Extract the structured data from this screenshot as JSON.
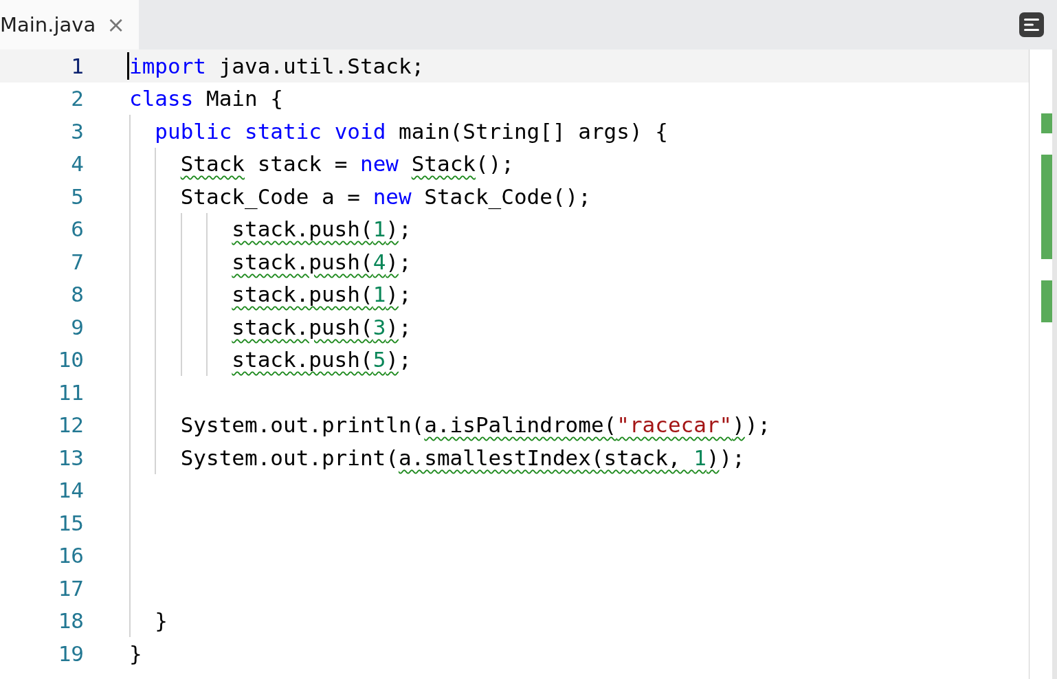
{
  "tabs": [
    {
      "label": "Main.java",
      "selected": true,
      "close": "×"
    }
  ],
  "lines": [
    {
      "number": "1",
      "current": true,
      "tokens": [
        {
          "text": "import",
          "kind": "keyword",
          "warning": false
        },
        {
          "text": " java.util.Stack;",
          "kind": "plain",
          "warning": false
        }
      ]
    },
    {
      "number": "2",
      "current": false,
      "tokens": [
        {
          "text": "class",
          "kind": "keyword",
          "warning": false
        },
        {
          "text": " Main {",
          "kind": "plain",
          "warning": false
        }
      ]
    },
    {
      "number": "3",
      "current": false,
      "tokens": [
        {
          "text": "  public",
          "kind": "keyword",
          "warning": false
        },
        {
          "text": " static",
          "kind": "keyword",
          "warning": false
        },
        {
          "text": " void",
          "kind": "keyword",
          "warning": false
        },
        {
          "text": " main(String[] args) {",
          "kind": "plain",
          "warning": false
        }
      ]
    },
    {
      "number": "4",
      "current": false,
      "tokens": [
        {
          "text": "    Stack",
          "kind": "plain",
          "warning": true
        },
        {
          "text": " stack =",
          "kind": "plain",
          "warning": false
        },
        {
          "text": " new",
          "kind": "keyword",
          "warning": false
        },
        {
          "text": " Stack",
          "kind": "plain",
          "warning": true
        },
        {
          "text": "();",
          "kind": "plain",
          "warning": false
        }
      ]
    },
    {
      "number": "5",
      "current": false,
      "tokens": [
        {
          "text": "    Stack_Code a =",
          "kind": "plain",
          "warning": false
        },
        {
          "text": " new",
          "kind": "keyword",
          "warning": false
        },
        {
          "text": " Stack_Code();",
          "kind": "plain",
          "warning": false
        }
      ]
    },
    {
      "number": "6",
      "current": false,
      "tokens": [
        {
          "text": "        stack.push(",
          "kind": "plain",
          "warning": true
        },
        {
          "text": "1",
          "kind": "number",
          "warning": true
        },
        {
          "text": ")",
          "kind": "plain",
          "warning": true
        },
        {
          "text": ";",
          "kind": "plain",
          "warning": false
        }
      ]
    },
    {
      "number": "7",
      "current": false,
      "tokens": [
        {
          "text": "        stack.push(",
          "kind": "plain",
          "warning": true
        },
        {
          "text": "4",
          "kind": "number",
          "warning": true
        },
        {
          "text": ")",
          "kind": "plain",
          "warning": true
        },
        {
          "text": ";",
          "kind": "plain",
          "warning": false
        }
      ]
    },
    {
      "number": "8",
      "current": false,
      "tokens": [
        {
          "text": "        stack.push(",
          "kind": "plain",
          "warning": true
        },
        {
          "text": "1",
          "kind": "number",
          "warning": true
        },
        {
          "text": ")",
          "kind": "plain",
          "warning": true
        },
        {
          "text": ";",
          "kind": "plain",
          "warning": false
        }
      ]
    },
    {
      "number": "9",
      "current": false,
      "tokens": [
        {
          "text": "        stack.push(",
          "kind": "plain",
          "warning": true
        },
        {
          "text": "3",
          "kind": "number",
          "warning": true
        },
        {
          "text": ")",
          "kind": "plain",
          "warning": true
        },
        {
          "text": ";",
          "kind": "plain",
          "warning": false
        }
      ]
    },
    {
      "number": "10",
      "current": false,
      "tokens": [
        {
          "text": "        stack.push(",
          "kind": "plain",
          "warning": true
        },
        {
          "text": "5",
          "kind": "number",
          "warning": true
        },
        {
          "text": ")",
          "kind": "plain",
          "warning": true
        },
        {
          "text": ";",
          "kind": "plain",
          "warning": false
        }
      ]
    },
    {
      "number": "11",
      "current": false
    },
    {
      "number": "12",
      "current": false,
      "tokens": [
        {
          "text": "    System.out.println(",
          "kind": "plain",
          "warning": false
        },
        {
          "text": "a.isPalindrome(",
          "kind": "plain",
          "warning": true
        },
        {
          "text": "\"racecar\"",
          "kind": "string",
          "warning": true
        },
        {
          "text": ")",
          "kind": "plain",
          "warning": true
        },
        {
          "text": ");",
          "kind": "plain",
          "warning": false
        }
      ]
    },
    {
      "number": "13",
      "current": false,
      "tokens": [
        {
          "text": "    System.out.print(",
          "kind": "plain",
          "warning": false
        },
        {
          "text": "a.smallestIndex(stack, ",
          "kind": "plain",
          "warning": true
        },
        {
          "text": "1",
          "kind": "number",
          "warning": true
        },
        {
          "text": ")",
          "kind": "plain",
          "warning": true
        },
        {
          "text": ");",
          "kind": "plain",
          "warning": false
        }
      ]
    },
    {
      "number": "14",
      "current": false
    },
    {
      "number": "15",
      "current": false
    },
    {
      "number": "16",
      "current": false
    },
    {
      "number": "17",
      "current": false
    },
    {
      "number": "18",
      "current": false,
      "tokens": [
        {
          "text": "  }",
          "kind": "plain",
          "warning": false
        }
      ]
    },
    {
      "number": "19",
      "current": false,
      "tokens": [
        {
          "text": "}",
          "kind": "plain",
          "warning": false
        }
      ]
    }
  ]
}
